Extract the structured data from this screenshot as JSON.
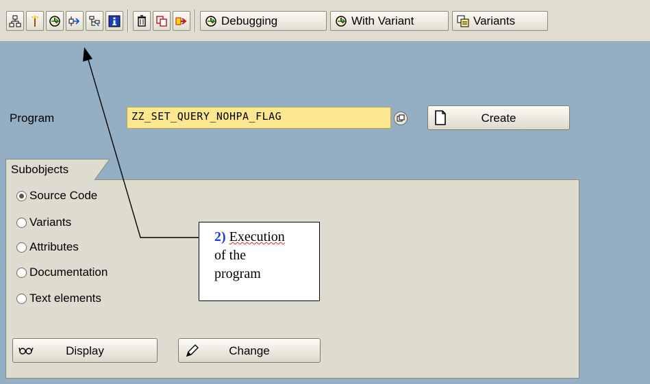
{
  "toolbar": {
    "icons": [
      "hierarchy-icon",
      "magic-wand-icon",
      "execute-icon",
      "where-used-icon",
      "display-object-list-icon",
      "info-icon",
      "delete-icon",
      "copy-icon",
      "rename-icon"
    ],
    "debugging_label": "Debugging",
    "with_variant_label": "With Variant",
    "variants_label": "Variants"
  },
  "program": {
    "label": "Program",
    "value": "ZZ_SET_QUERY_NOHPA_FLAG",
    "create_label": "Create"
  },
  "subobjects": {
    "title": "Subobjects",
    "options": [
      {
        "label": "Source Code",
        "selected": true
      },
      {
        "label": "Variants",
        "selected": false
      },
      {
        "label": "Attributes",
        "selected": false
      },
      {
        "label": "Documentation",
        "selected": false
      },
      {
        "label": "Text elements",
        "selected": false
      }
    ],
    "display_label": "Display",
    "change_label": "Change"
  },
  "callout": {
    "number": "2)",
    "word1": "Execution",
    "line2": "of the",
    "line3": "program"
  },
  "colors": {
    "background": "#94afc4",
    "input_required": "#fbe78f",
    "panel": "#dedbcf",
    "callout_number": "#1f3fd6"
  }
}
